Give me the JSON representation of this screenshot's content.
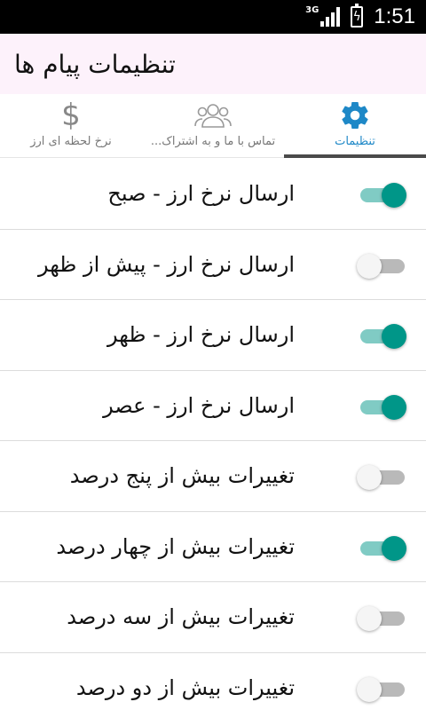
{
  "status_bar": {
    "network": "3G",
    "time": "1:51"
  },
  "header": {
    "title": "تنظیمات پیام ها"
  },
  "tabs": [
    {
      "label": "تنظیمات",
      "icon": "gear-icon",
      "active": true
    },
    {
      "label": "...تماس با ما و به اشتراک",
      "icon": "people-icon",
      "active": false
    },
    {
      "label": "نرخ لحظه ای ارز",
      "icon": "dollar-icon",
      "active": false
    }
  ],
  "tab_icons": {
    "dollar": "$"
  },
  "colors": {
    "accent": "#1e88c7",
    "switch_on": "#009688",
    "switch_off": "#b9b9b9",
    "header_bg": "#fdf2fb"
  },
  "settings": [
    {
      "label": "ارسال نرخ ارز - صبح",
      "enabled": true
    },
    {
      "label": "ارسال نرخ ارز - پیش از ظهر",
      "enabled": false
    },
    {
      "label": "ارسال نرخ ارز - ظهر",
      "enabled": true
    },
    {
      "label": "ارسال نرخ ارز - عصر",
      "enabled": true
    },
    {
      "label": "تغییرات بیش از پنج درصد",
      "enabled": false
    },
    {
      "label": "تغییرات بیش از چهار درصد",
      "enabled": true
    },
    {
      "label": "تغییرات بیش از سه درصد",
      "enabled": false
    },
    {
      "label": "تغییرات بیش از دو درصد",
      "enabled": false
    }
  ]
}
